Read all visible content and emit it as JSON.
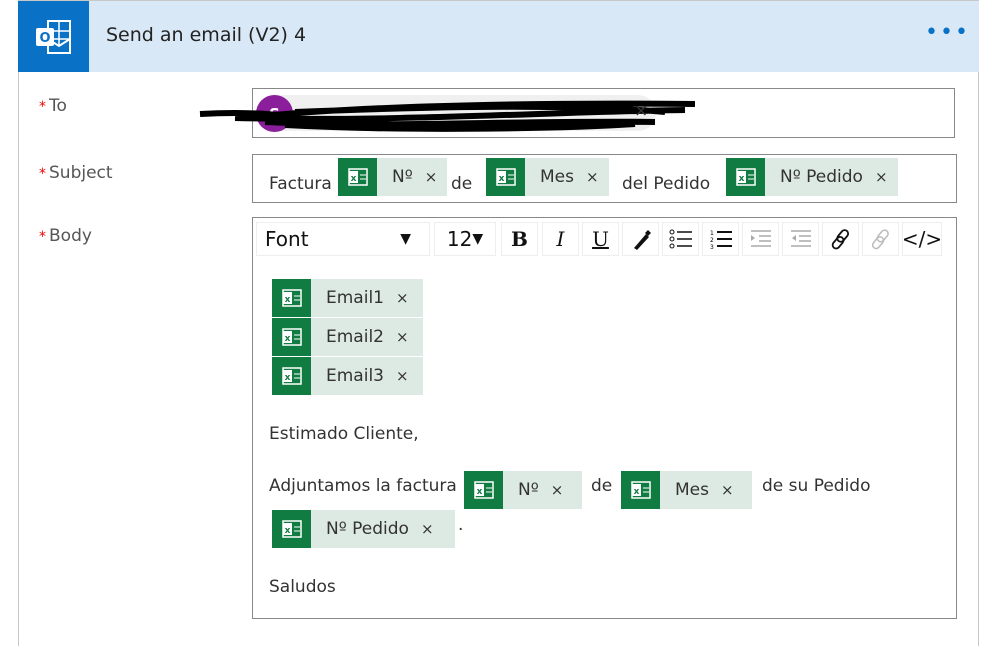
{
  "header": {
    "title": "Send an email (V2) 4",
    "more": "•••"
  },
  "fields": {
    "to": "To",
    "subject": "Subject",
    "body": "Body"
  },
  "to": {
    "avatar_initial": "S",
    "remove": "×"
  },
  "subject": {
    "text1": "Factura",
    "token1": "Nº",
    "text2": "de",
    "token2": "Mes",
    "text3": "del Pedido",
    "token3": "Nº Pedido"
  },
  "toolbar": {
    "font": "Font",
    "size": "12",
    "bold": "B",
    "italic": "I",
    "underline": "U",
    "code": "</>"
  },
  "body": {
    "tokens": [
      "Email1",
      "Email2",
      "Email3"
    ],
    "greeting": "Estimado Cliente,",
    "line_text1": "Adjuntamos la factura",
    "line_token1": "Nº",
    "line_text2": "de",
    "line_token2": "Mes",
    "line_text3": "de su Pedido",
    "line_token3": "Nº Pedido",
    "period": ".",
    "closing": "Saludos"
  },
  "remove": "×",
  "colors": {
    "header_bg": "#d9e8f6",
    "outlook_blue": "#0a72c6",
    "excel_green": "#107c41",
    "token_bg": "#dde9e3",
    "avatar": "#8a1e9b"
  }
}
